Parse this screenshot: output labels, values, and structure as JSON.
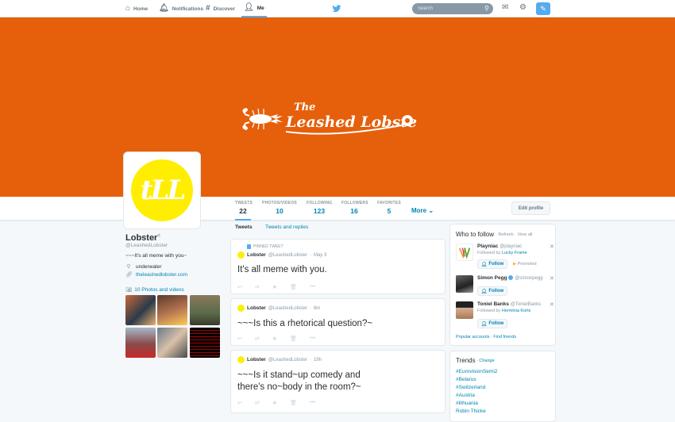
{
  "nav": {
    "home": "Home",
    "notifications": "Notifications",
    "discover": "Discover",
    "me": "Me",
    "search_placeholder": "Search"
  },
  "banner": {
    "logo_text": "The Leashed Lobster",
    "color": "#e65f0a"
  },
  "avatar": {
    "text": "tLL",
    "color": "#ffee00"
  },
  "stats": [
    {
      "label": "TWEETS",
      "value": "22"
    },
    {
      "label": "PHOTOS/VIDEOS",
      "value": "10"
    },
    {
      "label": "FOLLOWING",
      "value": "123"
    },
    {
      "label": "FOLLOWERS",
      "value": "16"
    },
    {
      "label": "FAVORITES",
      "value": "5"
    }
  ],
  "more_label": "More",
  "edit_profile": "Edit profile",
  "profile": {
    "name": "Lobster",
    "handle": "@LeashedLobster",
    "bio": "~~~It's all meme with you~",
    "location": "underwater",
    "url": "theleashedlobster.com",
    "photos_label": "10 Photos and videos"
  },
  "tabs": {
    "tweets": "Tweets",
    "replies": "Tweets and replies"
  },
  "pinned_label": "PINNED TWEET",
  "tweets": [
    {
      "name": "Lobster",
      "handle": "@LeashedLobster",
      "time": "May 3",
      "text": "It's all meme with you."
    },
    {
      "name": "Lobster",
      "handle": "@LeashedLobster",
      "time": "6m",
      "text": "~~~Is this a rhetorical question?~"
    },
    {
      "name": "Lobster",
      "handle": "@LeashedLobster",
      "time": "19h",
      "text1": "~~~Is it stand~up comedy and",
      "text2": "there's no~body in the room?~"
    }
  ],
  "who_to_follow": {
    "title": "Who to follow",
    "links": "· Refresh · View all",
    "follow_label": "Follow",
    "promoted": "Promoted",
    "footer": "Popular accounts · Find friends",
    "suggestions": [
      {
        "name": "Playniac",
        "handle": "@playniac",
        "followed_by_prefix": "Followed by",
        "followed_by": "Lucky Frame"
      },
      {
        "name": "Simon Pegg",
        "handle": "@simonpegg"
      },
      {
        "name": "Toniel Banks",
        "handle": "@TonielBanks",
        "followed_by_prefix": "Followed by",
        "followed_by": "Herminia Korts"
      }
    ]
  },
  "trends": {
    "title": "Trends",
    "change": "· Change",
    "items": [
      "#EurovisionSemi2",
      "#Belarus",
      "#Switzerland",
      "#Austria",
      "#lithuania",
      "Robin Thicke"
    ]
  }
}
